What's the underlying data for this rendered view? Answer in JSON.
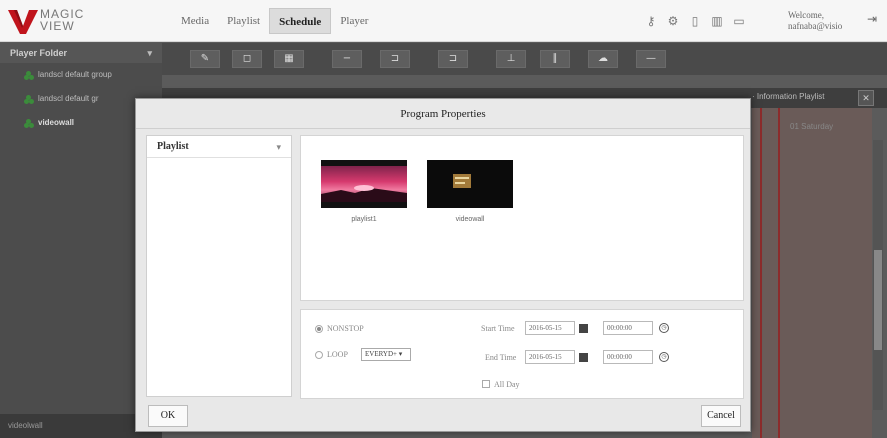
{
  "app": {
    "logo_text": "MAGIC VIEW",
    "logo_line1": "MAGIC",
    "logo_line2": "VIEW"
  },
  "nav": {
    "tabs": [
      {
        "label": "Media"
      },
      {
        "label": "Playlist"
      },
      {
        "label": "Schedule",
        "active": true
      },
      {
        "label": "Player"
      }
    ]
  },
  "header": {
    "icons": [
      "key-icon",
      "gear-icon",
      "clipboard-icon",
      "bar-chart-icon",
      "monitor-icon"
    ],
    "welcome_line1": "Welcome,",
    "welcome_line2": "nafnaba@visio",
    "logout_icon": "logout-icon"
  },
  "left_panel": {
    "title": "Player Folder",
    "items": [
      {
        "label": "landscl default group"
      },
      {
        "label": "landscl default gr"
      },
      {
        "label": "videowall",
        "selected": true
      }
    ],
    "footer": "videolwall"
  },
  "background": {
    "right_header": "· Information Playlist",
    "right_col_label": "01 Saturday"
  },
  "modal": {
    "title": "Program Properties",
    "playlist_header": "Playlist",
    "thumbs": [
      {
        "label": "playlist1"
      },
      {
        "label": "videowall"
      }
    ],
    "options": {
      "nonstop_label": "NONSTOP",
      "loop_label": "LOOP",
      "loop_select": "EVERYD+",
      "start_time_label": "Start Time",
      "start_date": "2016-05-15",
      "start_time": "00:00:00",
      "end_time_label": "End Time",
      "end_date": "2016-05-15",
      "end_time": "00:00:00",
      "all_day_label": "All Day"
    },
    "ok_label": "OK",
    "cancel_label": "Cancel"
  },
  "colors": {
    "accent_red": "#c0141c",
    "group_green": "#3b8c3b"
  }
}
